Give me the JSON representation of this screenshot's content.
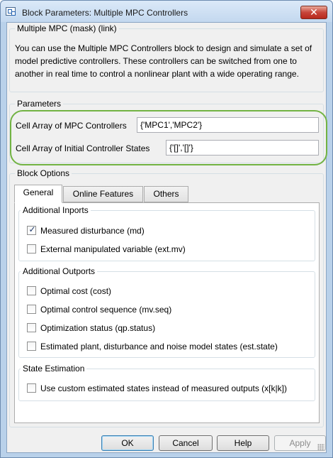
{
  "window": {
    "title": "Block Parameters: Multiple MPC Controllers",
    "close_glyph": "✕"
  },
  "mask": {
    "label": "Multiple MPC (mask) (link)",
    "description": "You can use the Multiple MPC Controllers block to design and simulate a set of model predictive controllers. These controllers can be switched from one to another in real time to control a nonlinear plant with a wide operating range."
  },
  "parameters": {
    "label": "Parameters",
    "controllers_label": "Cell Array of MPC Controllers",
    "controllers_value": "{'MPC1','MPC2'}",
    "initial_states_label": "Cell Array of Initial Controller States",
    "initial_states_value": "{'[]','[]'}"
  },
  "block_options": {
    "label": "Block Options",
    "tabs": [
      {
        "label": "General",
        "active": true
      },
      {
        "label": "Online Features",
        "active": false
      },
      {
        "label": "Others",
        "active": false
      }
    ],
    "additional_inports": {
      "label": "Additional Inports",
      "items": [
        {
          "label": "Measured disturbance (md)",
          "checked": true
        },
        {
          "label": "External manipulated variable (ext.mv)",
          "checked": false
        }
      ]
    },
    "additional_outports": {
      "label": "Additional Outports",
      "items": [
        {
          "label": "Optimal cost (cost)",
          "checked": false
        },
        {
          "label": "Optimal control sequence (mv.seq)",
          "checked": false
        },
        {
          "label": "Optimization status (qp.status)",
          "checked": false
        },
        {
          "label": "Estimated plant, disturbance and noise model states (est.state)",
          "checked": false
        }
      ]
    },
    "state_estimation": {
      "label": "State Estimation",
      "items": [
        {
          "label": "Use custom estimated states instead of measured outputs (x[k|k])",
          "checked": false
        }
      ]
    }
  },
  "buttons": {
    "ok": "OK",
    "cancel": "Cancel",
    "help": "Help",
    "apply": "Apply"
  },
  "check_glyph": "✓",
  "colors": {
    "highlight_ring": "#72b343",
    "client_bg": "#f0f0f0",
    "frame": "#b9d1ea"
  }
}
